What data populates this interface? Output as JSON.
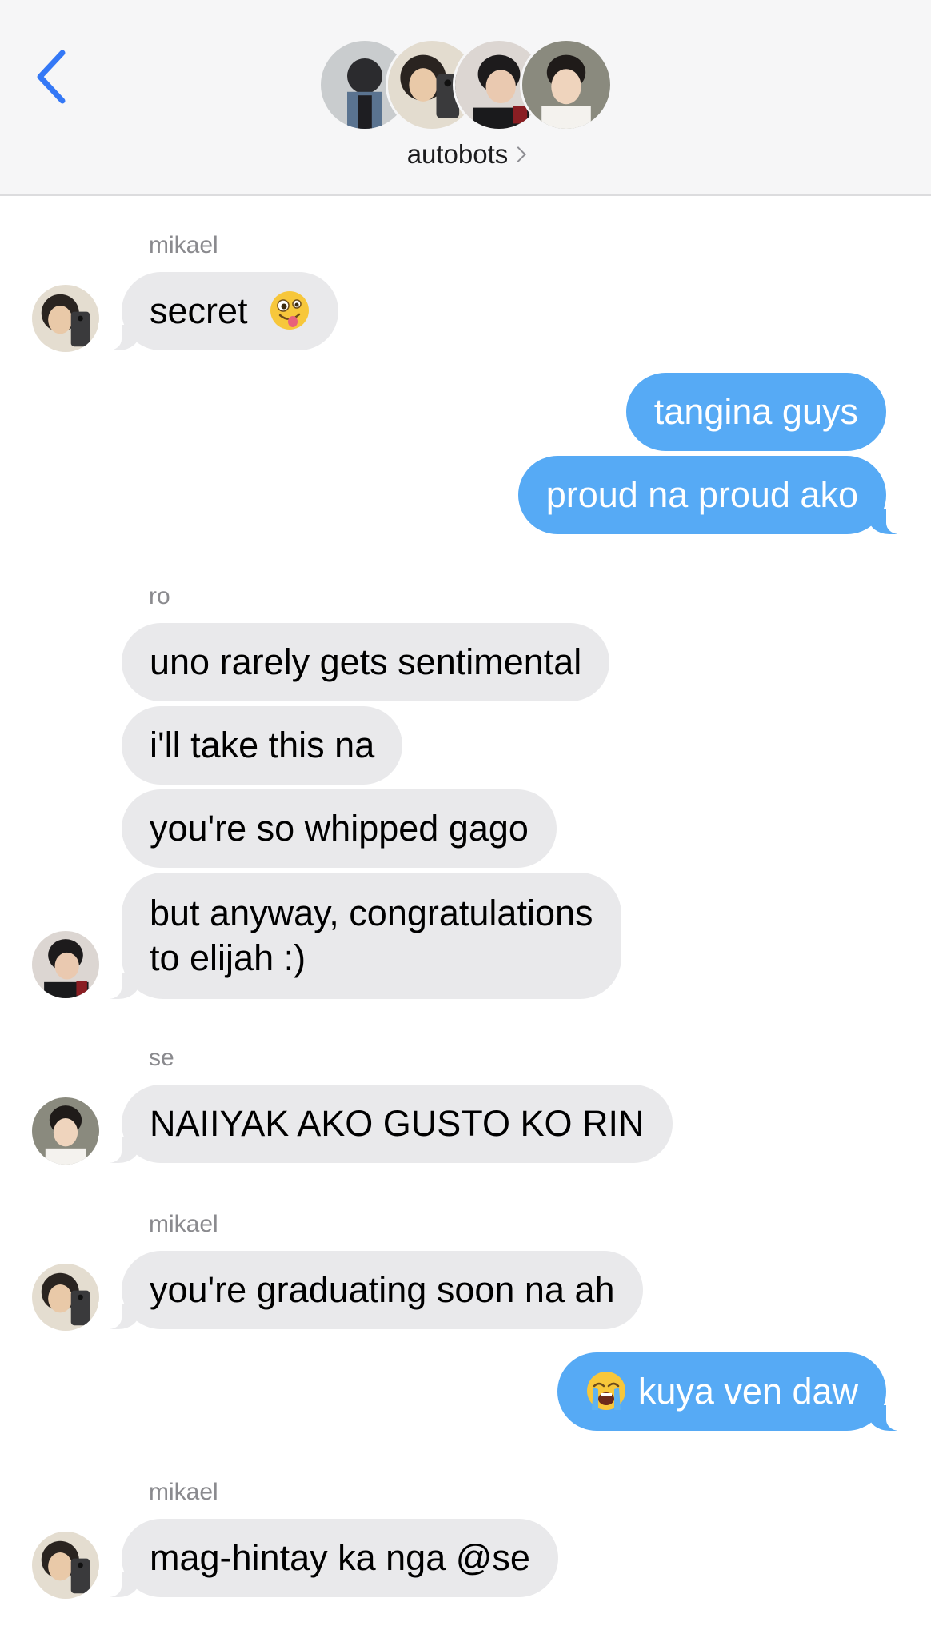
{
  "header": {
    "back_icon": "chevron-left-icon",
    "group_name": "autobots",
    "accent": "#3478f6"
  },
  "colors": {
    "incoming": "#e9e9eb",
    "outgoing": "#56aaf5"
  },
  "messages": {
    "m1_sender": "mikael",
    "m1_text": "secret",
    "m2_text": "tangina guys",
    "m3_text": "proud na proud ako",
    "m4_sender": "ro",
    "m4_text": "uno rarely gets sentimental",
    "m5_text": "i'll take this na",
    "m6_text": "you're so whipped gago",
    "m7_line1": "but anyway, congratulations",
    "m7_line2": "to elijah :)",
    "m8_sender": "se",
    "m8_text": "NAIIYAK AKO GUSTO KO RIN",
    "m9_sender": "mikael",
    "m9_text": "you're graduating soon na ah",
    "m10_text": "kuya ven daw",
    "m11_sender": "mikael",
    "m11_text": "mag-hintay ka nga @se"
  }
}
